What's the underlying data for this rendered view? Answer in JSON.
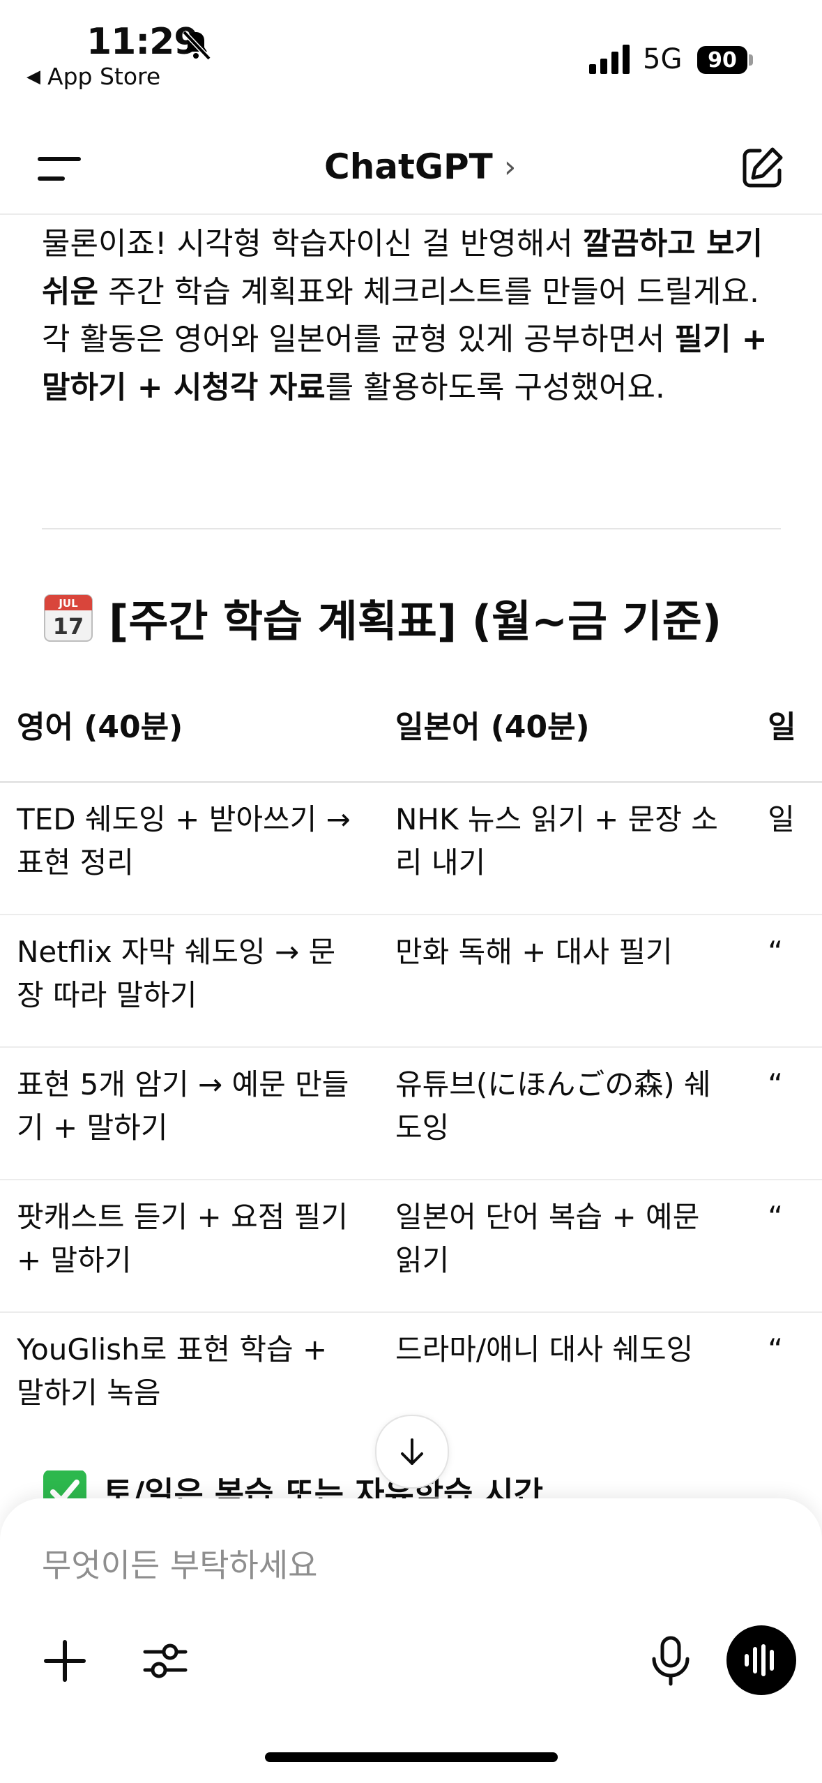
{
  "status_bar": {
    "time": "11:29",
    "back_app": "App Store",
    "network": "5G",
    "battery": "90"
  },
  "nav": {
    "title": "ChatGPT",
    "chevron": "›"
  },
  "message": {
    "p1": "물론이죠! 시각형 학습자이신 걸 반영해서 ",
    "b1": "깔끔하고 보기 쉬운",
    "p2": " 주간 학습 계획표와 체크리스트를 만들어 드릴게요. 각 활동은 영어와 일본어를 균형 있게 공부하면서 ",
    "b2": "필기 + 말하기 + 시청각 자료",
    "p3": "를 활용하도록 구성했어요."
  },
  "section": {
    "title": "[주간 학습 계획표] (월~금 기준)",
    "icon": "calendar-icon"
  },
  "table": {
    "headers": [
      "영어 (40분)",
      "일본어 (40분)",
      "일"
    ],
    "rows": [
      [
        "TED 쉐도잉 + 받아쓰기 → 표현 정리",
        "NHK 뉴스 읽기 + 문장 소리 내기",
        "일"
      ],
      [
        "Netflix 자막 쉐도잉 → 문장 따라 말하기",
        "만화 독해 + 대사 필기",
        "“"
      ],
      [
        "표현 5개 암기 → 예문 만들기 + 말하기",
        "유튜브(にほんごの森) 쉐도잉",
        "“"
      ],
      [
        "팟캐스트 듣기 + 요점 필기 + 말하기",
        "일본어 단어 복습 + 예문 읽기",
        "“"
      ],
      [
        "YouGlish로 표현 학습 + 말하기 녹음",
        "드라마/애니 대사 쉐도잉",
        "“"
      ]
    ]
  },
  "peek": {
    "text": "토/일은 복습 또는 자유학습 시간",
    "icon": "check-mark-icon"
  },
  "composer": {
    "placeholder": "무엇이든 부탁하세요"
  },
  "colors": {
    "text": "#0d0d0d",
    "placeholder": "#8e8e8e",
    "check_green": "#2db84d"
  }
}
